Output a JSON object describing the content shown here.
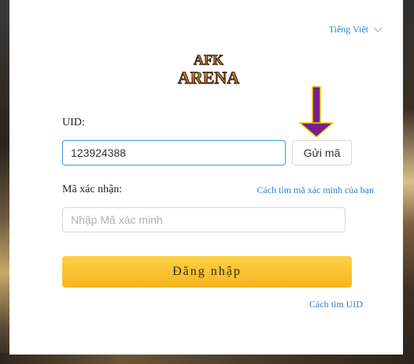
{
  "language_selector": {
    "label": "Tiếng Việt",
    "icon": "chevron-down-icon"
  },
  "logo": {
    "text_line1": "AFK",
    "text_line2": "ARENA"
  },
  "uid": {
    "label": "UID:",
    "value": "123924388"
  },
  "send_code": {
    "label": "Gửi mã"
  },
  "verification": {
    "label": "Mã xác nhận:",
    "help_link": "Cách tìm mã xác minh của bạn",
    "placeholder": "Nhập Mã xác minh"
  },
  "login": {
    "label": "Đăng nhập"
  },
  "find_uid_link": "Cách tìm UID",
  "colors": {
    "accent_link": "#2b7fd0",
    "login_button": "#f8c22e",
    "annotation_arrow": "#7a1f8a"
  }
}
